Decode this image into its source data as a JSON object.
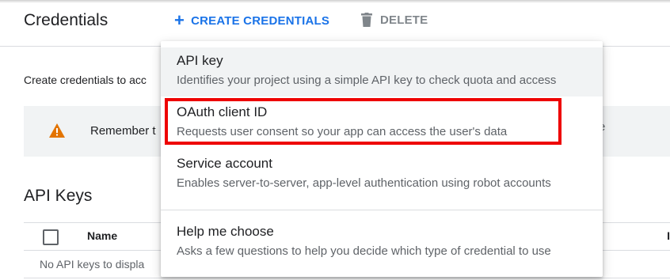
{
  "header": {
    "title": "Credentials",
    "create_label": "CREATE CREDENTIALS",
    "create_icon": "plus-icon",
    "delete_label": "DELETE",
    "delete_icon": "trash-icon"
  },
  "main": {
    "intro_text": "Create credentials to acc",
    "notice_text": "Remember t",
    "notice_trailing": "e",
    "notice_icon": "warning-icon",
    "api_keys_title": "API Keys",
    "table": {
      "columns": [
        "Name",
        "I"
      ],
      "empty_text": "No API keys to displa"
    }
  },
  "dropdown": {
    "items": [
      {
        "title": "API key",
        "description": "Identifies your project using a simple API key to check quota and access"
      },
      {
        "title": "OAuth client ID",
        "description": "Requests user consent so your app can access the user's data"
      },
      {
        "title": "Service account",
        "description": "Enables server-to-server, app-level authentication using robot accounts"
      },
      {
        "title": "Help me choose",
        "description": "Asks a few questions to help you decide which type of credential to use"
      }
    ]
  },
  "colors": {
    "accent": "#1a73e8",
    "highlight_border": "#ee0000",
    "warning": "#e37400"
  }
}
